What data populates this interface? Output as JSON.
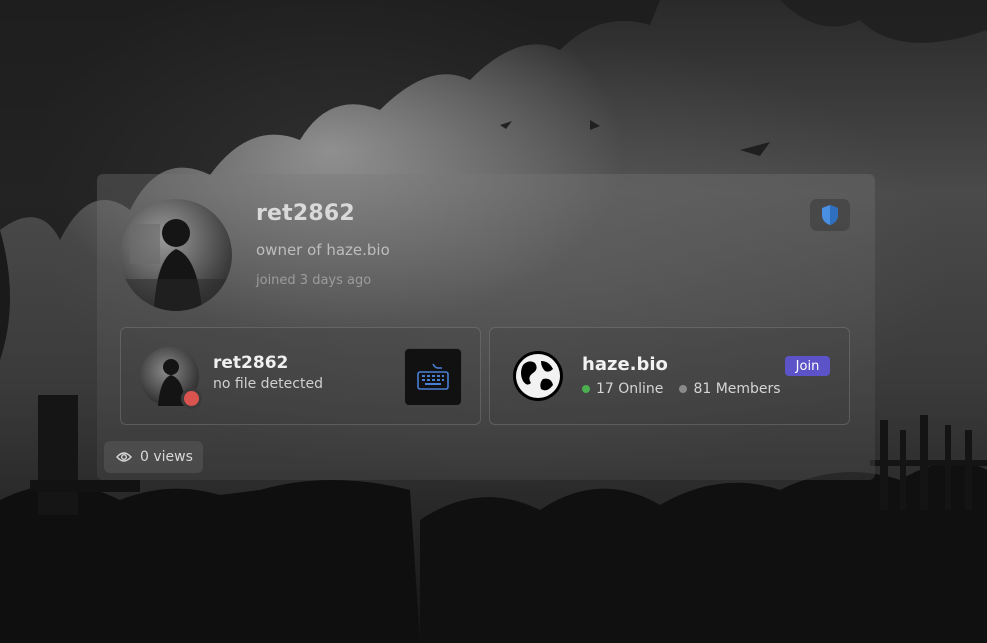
{
  "profile": {
    "username": "ret2862",
    "bio": "owner of haze.bio",
    "joined": "joined 3 days ago",
    "badge_icon": "shield-icon"
  },
  "presence": {
    "name": "ret2862",
    "status_text": "no file detected",
    "status_color": "#d9534f",
    "activity_icon": "keyboard-icon"
  },
  "server": {
    "name": "haze.bio",
    "join_label": "Join",
    "online": "17 Online",
    "members": "81 Members",
    "accent": "#5b53c7"
  },
  "views": {
    "label": "0 views",
    "icon": "eye-icon"
  }
}
